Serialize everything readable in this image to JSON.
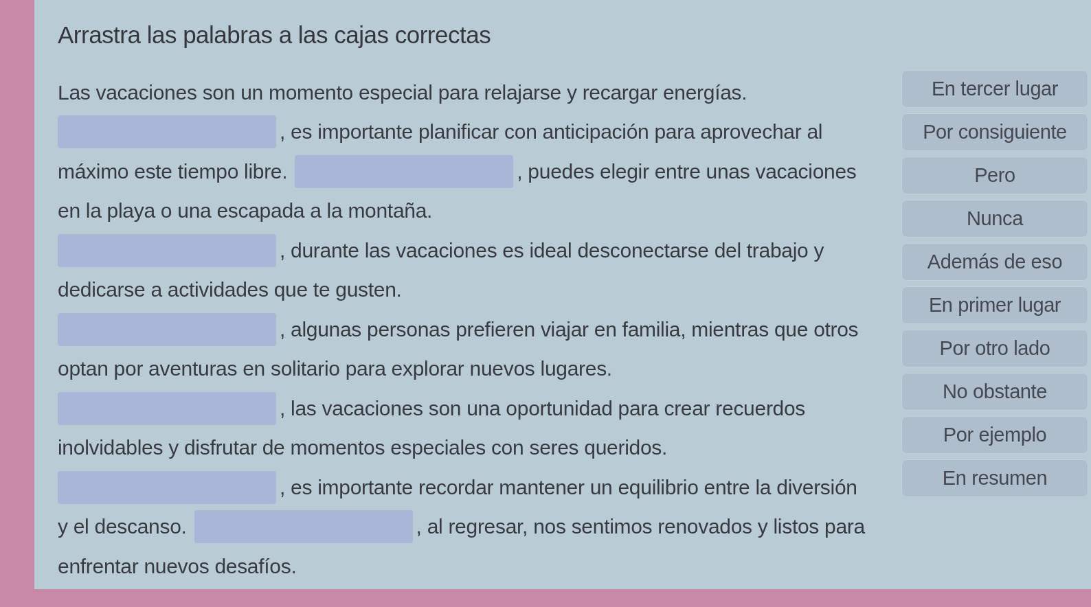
{
  "title": "Arrastra las palabras a las cajas correctas",
  "lines": [
    {
      "parts": [
        {
          "kind": "text",
          "text": "Las vacaciones son un momento especial para relajarse y recargar energías."
        }
      ]
    },
    {
      "parts": [
        {
          "kind": "blank"
        },
        {
          "kind": "text",
          "text": ", es importante planificar con anticipación para aprovechar al"
        }
      ]
    },
    {
      "parts": [
        {
          "kind": "text",
          "text": "máximo este tiempo libre."
        },
        {
          "kind": "blank"
        },
        {
          "kind": "text",
          "text": ", puedes elegir entre unas vacaciones"
        }
      ]
    },
    {
      "parts": [
        {
          "kind": "text",
          "text": "en la playa o una escapada a la montaña."
        }
      ]
    },
    {
      "parts": [
        {
          "kind": "blank"
        },
        {
          "kind": "text",
          "text": ", durante las vacaciones es ideal desconectarse del trabajo y"
        }
      ]
    },
    {
      "parts": [
        {
          "kind": "text",
          "text": "dedicarse a actividades que te gusten."
        }
      ]
    },
    {
      "parts": [
        {
          "kind": "blank"
        },
        {
          "kind": "text",
          "text": ", algunas personas prefieren viajar en familia, mientras que otros"
        }
      ]
    },
    {
      "parts": [
        {
          "kind": "text",
          "text": "optan por aventuras en solitario para explorar nuevos lugares."
        }
      ]
    },
    {
      "parts": [
        {
          "kind": "blank"
        },
        {
          "kind": "text",
          "text": ", las vacaciones son una oportunidad para crear recuerdos"
        }
      ]
    },
    {
      "parts": [
        {
          "kind": "text",
          "text": "inolvidables y disfrutar de momentos especiales con seres queridos."
        }
      ]
    },
    {
      "parts": [
        {
          "kind": "blank"
        },
        {
          "kind": "text",
          "text": ", es importante recordar mantener un equilibrio entre la diversión"
        }
      ]
    },
    {
      "parts": [
        {
          "kind": "text",
          "text": "y el descanso."
        },
        {
          "kind": "blank"
        },
        {
          "kind": "text",
          "text": ", al regresar, nos sentimos renovados y listos para"
        }
      ]
    },
    {
      "parts": [
        {
          "kind": "text",
          "text": "enfrentar nuevos desafíos."
        }
      ]
    }
  ],
  "word_bank": [
    "En tercer lugar",
    "Por consiguiente",
    "Pero",
    "Nunca",
    "Además de eso",
    "En primer lugar",
    "Por otro lado",
    "No obstante",
    "Por ejemplo",
    "En resumen"
  ]
}
